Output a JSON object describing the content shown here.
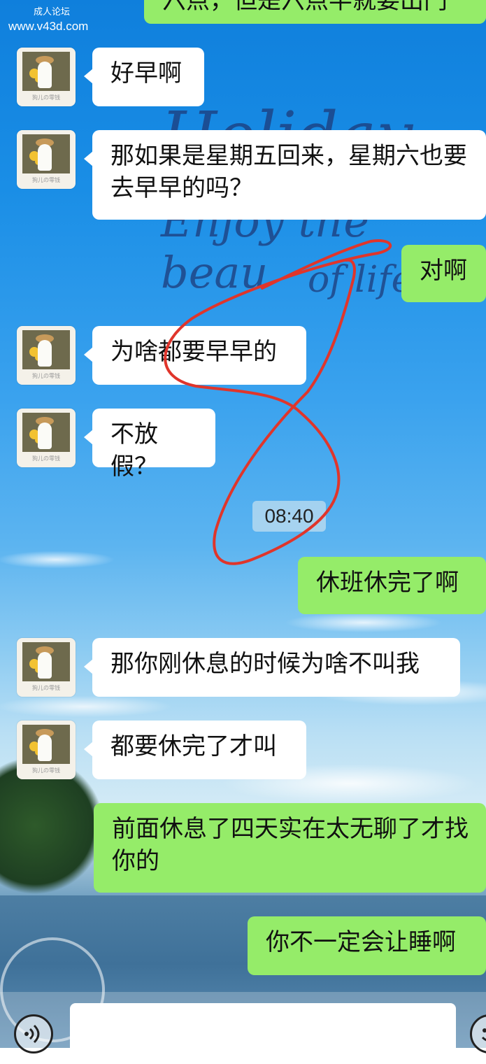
{
  "watermarks": {
    "top_label": "成人论坛",
    "site": "www.v43d.com"
  },
  "colors": {
    "incoming_bubble": "#ffffff",
    "outgoing_bubble": "#95ec69",
    "scribble": "#e0352b"
  },
  "background_script": {
    "line1": "Holiday",
    "line2": "Enjoy the beau",
    "line3": "of life"
  },
  "messages": [
    {
      "side": "out",
      "text": "六点，但是六点半就要出门"
    },
    {
      "side": "in",
      "text": "好早啊"
    },
    {
      "side": "in",
      "text": "那如果是星期五回来，星期六也要去早早的吗？"
    },
    {
      "side": "out",
      "text": "对啊"
    },
    {
      "side": "in",
      "text": "为啥都要早早的"
    },
    {
      "side": "in",
      "text": "不放假？"
    },
    {
      "side": "out",
      "text": "休班休完了啊"
    },
    {
      "side": "in",
      "text": "那你刚休息的时候为啥不叫我"
    },
    {
      "side": "in",
      "text": "都要休完了才叫"
    },
    {
      "side": "out",
      "text": "前面休息了四天实在太无聊了才找你的"
    },
    {
      "side": "out",
      "text": "你不一定会让睡啊"
    }
  ],
  "timestamp": "08:40",
  "avatar_caption": "狗儿の零钱",
  "input_bar": {
    "voice_icon": "voice-icon",
    "emoji_icon": "emoji-icon"
  }
}
